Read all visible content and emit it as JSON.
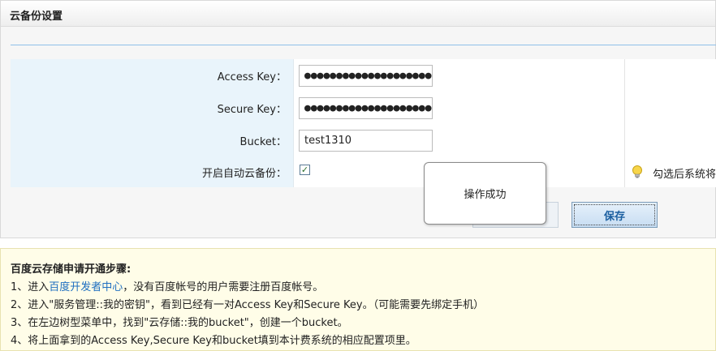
{
  "panel": {
    "title": "云备份设置"
  },
  "form": {
    "access_key": {
      "label": "Access Key：",
      "value": "●●●●●●●●●●●●●●●●●●●●"
    },
    "secure_key": {
      "label": "Secure Key：",
      "value": "●●●●●●●●●●●●●●●●●●●●"
    },
    "bucket": {
      "label": "Bucket：",
      "value": "test1310"
    },
    "auto_backup": {
      "label": "开启自动云备份：",
      "checked": true,
      "check_mark": "✓",
      "hint": "勾选后系统将"
    }
  },
  "buttons": {
    "save_label": "保存"
  },
  "toast": {
    "message": "操作成功"
  },
  "help": {
    "title": "百度云存储申请开通步骤:",
    "step1_prefix": "1、进入",
    "step1_link": "百度开发者中心",
    "step1_suffix": "，没有百度帐号的用户需要注册百度帐号。",
    "step2": "2、进入\"服务管理::我的密钥\"，看到已经有一对Access Key和Secure Key。（可能需要先绑定手机）",
    "step3": "3、在左边树型菜单中，找到\"云存储::我的bucket\"，创建一个bucket。",
    "step4": "4、将上面拿到的Access Key,Secure Key和bucket填到本计费系统的相应配置项里。"
  },
  "colors": {
    "accent": "#1f6fc0",
    "label_bg": "#e9f4fb",
    "help_bg": "#fffde8"
  },
  "icons": {
    "hint": "lightbulb-icon",
    "checkbox": "checkmark-icon"
  }
}
